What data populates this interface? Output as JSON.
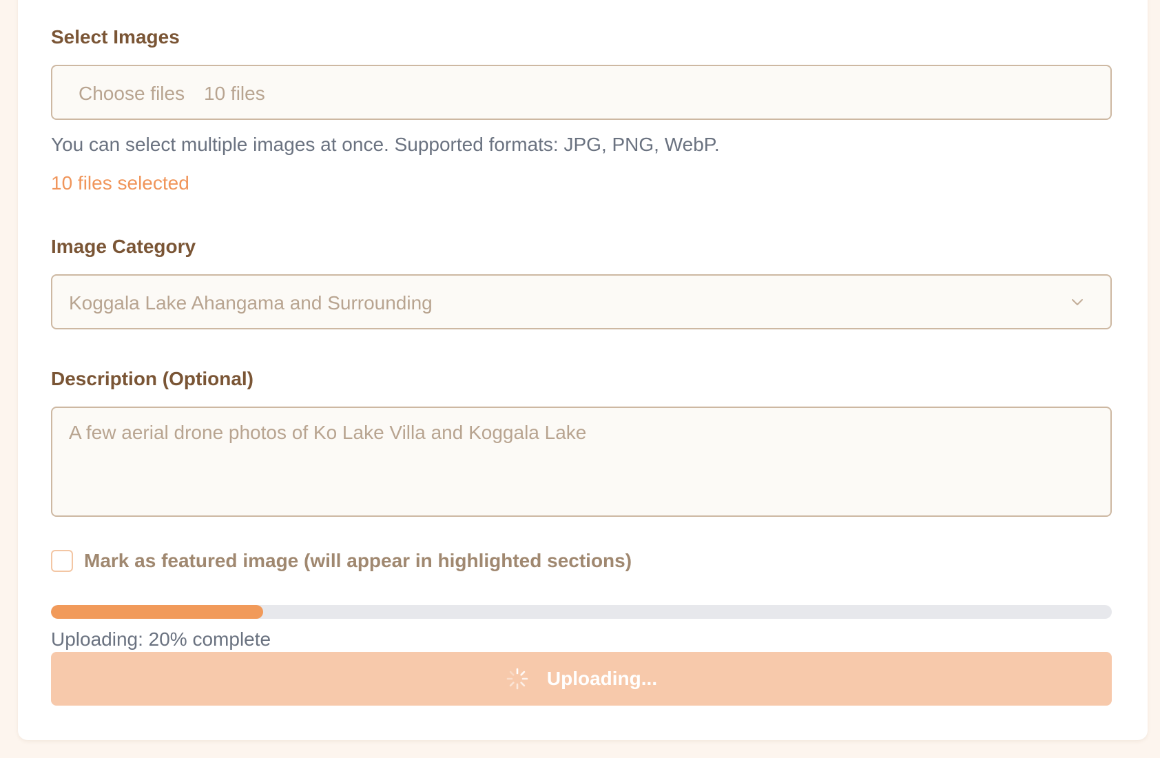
{
  "upload_form": {
    "images_label": "Select Images",
    "choose_files_button": "Choose files",
    "file_input_status": "10 files",
    "help_text": "You can select multiple images at once. Supported formats: JPG, PNG, WebP.",
    "selected_count_text": "10 files selected",
    "category_label": "Image Category",
    "category_value": "Koggala Lake Ahangama and Surrounding",
    "description_label": "Description (Optional)",
    "description_value": "A few aerial drone photos of Ko Lake Villa and Koggala Lake",
    "featured_checked": false,
    "featured_label": "Mark as featured image (will appear in highlighted sections)",
    "progress_fraction": 0.2,
    "progress_text": "Uploading: 20% complete",
    "submit_label": "Uploading..."
  },
  "icons": {
    "select_chevron": "chevron-down-icon",
    "submit_spinner": "spinner-icon"
  },
  "colors": {
    "page_background": "#fdf5ee",
    "card_background": "#ffffff",
    "label_brown": "#7a5535",
    "accent_orange": "#f0955a",
    "progress_fill": "#f19a5a",
    "progress_track": "#e7e8ec",
    "button_disabled": "#f7c9ab",
    "muted_text": "#6a7280",
    "input_placeholder": "#b8a490"
  }
}
